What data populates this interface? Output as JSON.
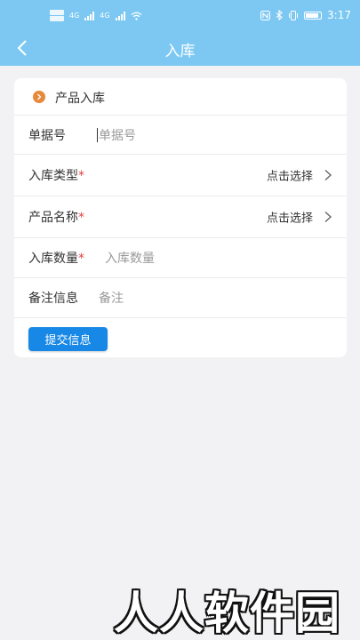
{
  "status_bar": {
    "time": "3:17",
    "sim1": "4G",
    "sim2": "4G",
    "icons": [
      "nfc-icon",
      "bluetooth-icon",
      "vibrate-icon",
      "battery-icon"
    ]
  },
  "navbar": {
    "title": "入库",
    "back_icon": "chevron-left-icon"
  },
  "form": {
    "section_title": "产品入库",
    "fields": [
      {
        "label": "单据号",
        "required": false,
        "placeholder": "单据号"
      },
      {
        "label": "入库类型",
        "required": true,
        "select_text": "点击选择"
      },
      {
        "label": "产品名称",
        "required": true,
        "select_text": "点击选择"
      },
      {
        "label": "入库数量",
        "required": true,
        "placeholder": "入库数量"
      },
      {
        "label": "备注信息",
        "required": false,
        "placeholder": "备注"
      }
    ],
    "required_mark": "*",
    "submit_label": "提交信息"
  },
  "watermark": "人人软件园",
  "colors": {
    "header": "#7cc8f2",
    "accent": "#1888e6",
    "section_icon": "#e6893a",
    "required": "#e04040",
    "background": "#f2f2f4"
  }
}
